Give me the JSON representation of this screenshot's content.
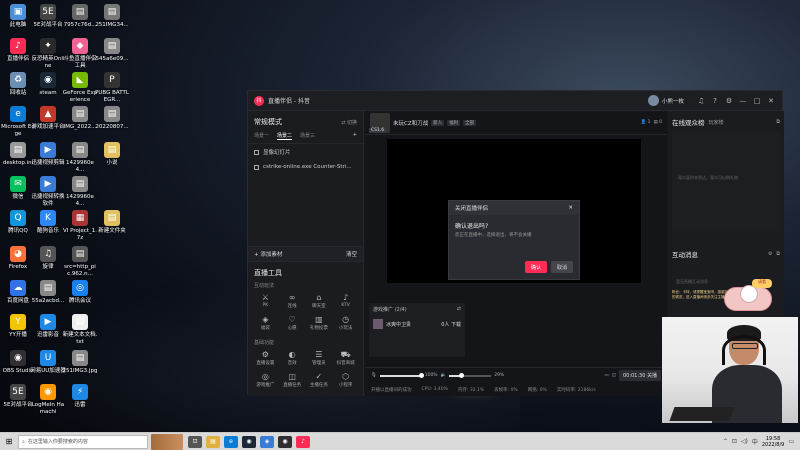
{
  "desktop": {
    "icons": [
      {
        "label": "此电脑",
        "color": "#4a90d9",
        "glyph": "▣"
      },
      {
        "label": "5E对战平台",
        "color": "#444",
        "glyph": "5E"
      },
      {
        "label": "7957c76d...",
        "color": "#666",
        "glyph": "▤"
      },
      {
        "label": "251IMG34...",
        "color": "#777",
        "glyph": "▤"
      },
      {
        "label": "直播伴侣",
        "color": "#fe2c55",
        "glyph": "♪"
      },
      {
        "label": "反恐精英Online",
        "color": "#2a2a2a",
        "glyph": "✦"
      },
      {
        "label": "斗鱼直播伴侣工具",
        "color": "#f06292",
        "glyph": "◆"
      },
      {
        "label": "545a6e09...",
        "color": "#888",
        "glyph": "▤"
      },
      {
        "label": "回收站",
        "color": "#6b8fb5",
        "glyph": "♻"
      },
      {
        "label": "steam",
        "color": "#1b2838",
        "glyph": "◉"
      },
      {
        "label": "GeForce Experience",
        "color": "#76b900",
        "glyph": "◣"
      },
      {
        "label": "PUBG BATTLEGR...",
        "color": "#333",
        "glyph": "P"
      },
      {
        "label": "Microsoft Edge",
        "color": "#0a7cd6",
        "glyph": "e"
      },
      {
        "label": "游戏加速平台",
        "color": "#c0392b",
        "glyph": "▲"
      },
      {
        "label": "IMG_2022...",
        "color": "#888",
        "glyph": "▤"
      },
      {
        "label": "20220807...",
        "color": "#888",
        "glyph": "▤"
      },
      {
        "label": "desktop.ini",
        "color": "#999",
        "glyph": "▤"
      },
      {
        "label": "迅捷视频剪辑",
        "color": "#3a7bd5",
        "glyph": "▶"
      },
      {
        "label": "1429960e4...",
        "color": "#888",
        "glyph": "▤"
      },
      {
        "label": "小说",
        "color": "#e0c060",
        "glyph": "▤"
      },
      {
        "label": "微信",
        "color": "#07c160",
        "glyph": "✉"
      },
      {
        "label": "迅捷视频转换软件",
        "color": "#3a7bd5",
        "glyph": "▶"
      },
      {
        "label": "1429960e4...",
        "color": "#888",
        "glyph": "▤"
      },
      {
        "label": "腾讯QQ",
        "color": "#1296db",
        "glyph": "Q"
      },
      {
        "label": "酷狗音乐",
        "color": "#2b88ff",
        "glyph": "K"
      },
      {
        "label": "VI Project_1.7z",
        "color": "#a33",
        "glyph": "▦"
      },
      {
        "label": "新建文件夹",
        "color": "#e0c060",
        "glyph": "▤"
      },
      {
        "label": "Firefox",
        "color": "#ff7139",
        "glyph": "◕"
      },
      {
        "label": "旋律",
        "color": "#555",
        "glyph": "♫"
      },
      {
        "label": "src=http_pic.962.n...",
        "color": "#555",
        "glyph": "▤"
      },
      {
        "label": "百度网盘",
        "color": "#2f73e6",
        "glyph": "☁"
      },
      {
        "label": "55a2acbd...",
        "color": "#888",
        "glyph": "▤"
      },
      {
        "label": "腾讯会议",
        "color": "#1a7ff0",
        "glyph": "◎"
      },
      {
        "label": "YY开播",
        "color": "#f5c400",
        "glyph": "Y"
      },
      {
        "label": "迅雷影音",
        "color": "#1e88e5",
        "glyph": "▶"
      },
      {
        "label": "新建文本文档.txt",
        "color": "#eee",
        "glyph": "▤"
      },
      {
        "label": "OBS Studio",
        "color": "#302e31",
        "glyph": "◉"
      },
      {
        "label": "网易UU加速器",
        "color": "#1e88e5",
        "glyph": "U"
      },
      {
        "label": "251IMG3.jpg",
        "color": "#888",
        "glyph": "▤"
      },
      {
        "label": "5E对战平台",
        "color": "#444",
        "glyph": "5E"
      },
      {
        "label": "LogMeIn Hamachi",
        "color": "#ff9800",
        "glyph": "◉"
      },
      {
        "label": "迅雷",
        "color": "#1e88e5",
        "glyph": "⚡"
      }
    ]
  },
  "app": {
    "title": "直播伴侣 - 抖音",
    "logo_text": "抖",
    "user_name": "小熊一枚",
    "left": {
      "mode_title": "常规模式",
      "switch_label": "切换",
      "scenes": [
        "场景一",
        "场景二",
        "场景三"
      ],
      "sources": [
        {
          "label": "显像幻灯片"
        },
        {
          "label": "cstrike-online.exe Counter-Stri..."
        }
      ],
      "add_source_label": "+ 添加素材",
      "clear_label": "清空",
      "tools_title": "直播工具",
      "groups": [
        {
          "title": "互动玩法",
          "items": [
            {
              "icon": "⚔",
              "label": "PK"
            },
            {
              "icon": "∞",
              "label": "连线"
            },
            {
              "icon": "⌂",
              "label": "聊天室"
            },
            {
              "icon": "♪",
              "label": "KTV"
            },
            {
              "icon": "◈",
              "label": "福袋"
            },
            {
              "icon": "♡",
              "label": "心愿"
            },
            {
              "icon": "▥",
              "label": "礼物投票"
            },
            {
              "icon": "◷",
              "label": "小玩法"
            }
          ]
        },
        {
          "title": "基础功能",
          "items": [
            {
              "icon": "⚙",
              "label": "直播设置"
            },
            {
              "icon": "◐",
              "label": "音效"
            },
            {
              "icon": "☰",
              "label": "管理员"
            },
            {
              "icon": "⛟",
              "label": "抖音商城"
            },
            {
              "icon": "◎",
              "label": "游戏推广"
            },
            {
              "icon": "◫",
              "label": "直播任务"
            },
            {
              "icon": "✓",
              "label": "主播任务"
            },
            {
              "icon": "⬡",
              "label": "小程序"
            }
          ]
        }
      ]
    },
    "mid": {
      "anchor_name": "未玩CZ和刀战",
      "tags": [
        "新人",
        "福利",
        "全部"
      ],
      "level": "CS1.6",
      "viewers": "1",
      "likes": "0",
      "dialog": {
        "title": "关闭直播伴侣",
        "question": "确认退出吗?",
        "desc": "您正在直播中，选择退出，将不会关播",
        "confirm": "确认",
        "cancel": "取消"
      },
      "promo": {
        "title": "游戏推广 (2/4)",
        "item": "冰爽中卫贵",
        "count": "0人 下载"
      },
      "controls": {
        "mic_value": "100%",
        "speaker_value": "29%",
        "mic_fill": 1.0,
        "speaker_fill": 0.29,
        "duration": "00:01:30 关播"
      },
      "status": {
        "start_text": "开播以直播间的成功",
        "cpu": "CPU: 3.40%",
        "mem": "内存: 32.1%",
        "drop": "丢帧率: 0%",
        "net": "网络: 0%",
        "speed": "实时码率: 2186k/s"
      }
    },
    "right": {
      "online_title": "在线观众榜",
      "online_sub": "玩家榜",
      "online_empty": "观众暂时未到达，观众可以刷礼物",
      "interact_title": "互动消息",
      "interact_empty": "暂无直播互动消息"
    }
  },
  "overlay": {
    "bubble": "请看",
    "text": "粉丝：卡特，请提醒宝宝呀，感谢加入。请遵守直播平台的规范，进入直播间请多关注主播哦"
  },
  "taskbar": {
    "search_placeholder": "在这里输入你要搜索的内容",
    "time": "19:58",
    "date": "2022/8/9",
    "pinned": [
      {
        "name": "task-view",
        "glyph": "⊡",
        "color": "#555"
      },
      {
        "name": "file-explorer",
        "glyph": "▤",
        "color": "#e0b040"
      },
      {
        "name": "edge",
        "glyph": "e",
        "color": "#0a7cd6"
      },
      {
        "name": "steam",
        "glyph": "◉",
        "color": "#1b2838"
      },
      {
        "name": "app-blue",
        "glyph": "◈",
        "color": "#3a7bd5"
      },
      {
        "name": "obs",
        "glyph": "◉",
        "color": "#302e31"
      },
      {
        "name": "live-companion",
        "glyph": "♪",
        "color": "#fe2c55"
      }
    ]
  }
}
